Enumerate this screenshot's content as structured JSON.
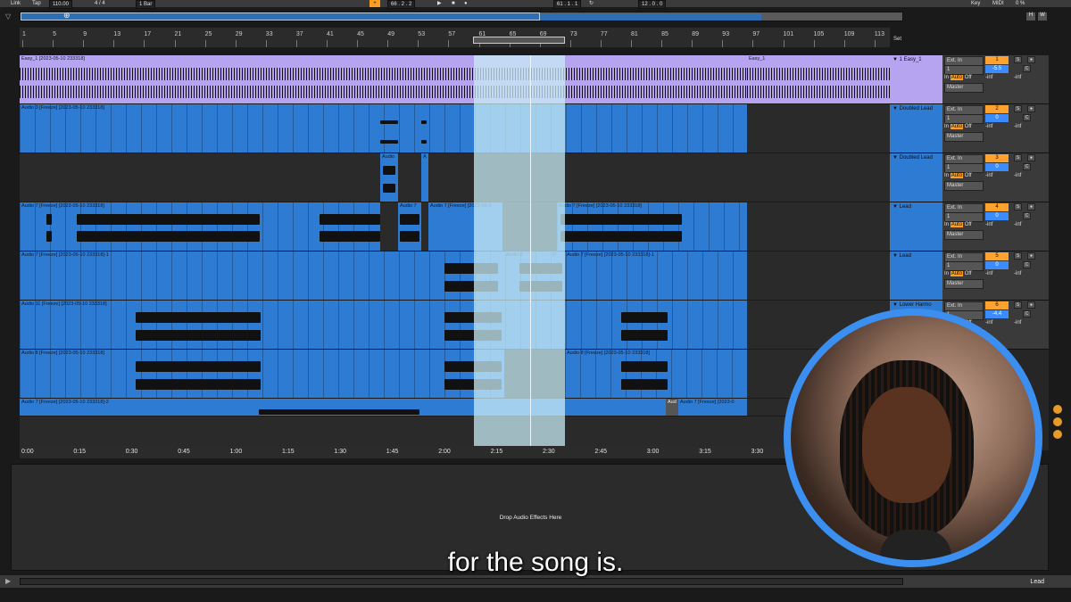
{
  "transport": {
    "link": "Link",
    "tap": "Tap",
    "tempo": "110.00",
    "signature": "4 / 4",
    "quantize": "1 Bar",
    "position": "66 . 2 . 2",
    "loop_start": "61 . 1 . 1",
    "loop_length": "12 . 0 . 0",
    "key": "Key",
    "midi": "MIDI",
    "cpu": "0 %"
  },
  "overview": {
    "h": "H",
    "w": "W"
  },
  "ruler": {
    "bars": [
      "1",
      "5",
      "9",
      "13",
      "17",
      "21",
      "25",
      "29",
      "33",
      "37",
      "41",
      "45",
      "49",
      "53",
      "57",
      "61",
      "65",
      "69",
      "73",
      "77",
      "81",
      "85",
      "89",
      "93",
      "97",
      "101",
      "105",
      "109",
      "113"
    ],
    "set_label": "Set"
  },
  "tracks": [
    {
      "clips": [
        "Easy_1 [2023-05-10 233318]",
        "Easy_1"
      ]
    },
    {
      "clips": [
        "Audio 3 [Freeze] [2023-05-10 233318]"
      ]
    },
    {
      "clips": [
        "Audio",
        "A"
      ]
    },
    {
      "clips": [
        "Audio 7 [Freeze] [2023-05-10 233318]",
        "Audio 7",
        "Audio 7 [Freeze] [2023-05-1",
        "Audio 7 [Freeze] [2023-05-10 233318]"
      ]
    },
    {
      "clips": [
        "Audio 7 [Freeze] [2023-05-10 233318]-1",
        "Audio 8",
        "[2",
        "Audio 7 [Freeze] [2023-05-10 233318]-1"
      ]
    },
    {
      "clips": [
        "Audio 11 [Freeze] [2023-05-10 233318]"
      ]
    },
    {
      "clips": [
        "Audio 8 [Freeze] [2023-05-10 233318]",
        "Audio 8 [Freeze] [2023-05-10 233318]"
      ]
    },
    {
      "clips": [
        "Audio 7 [Freeze] [2023-05-10 233318]-2",
        "Aud",
        "Audio 7 [Freeze] [2023-0"
      ]
    }
  ],
  "heads": [
    {
      "name": "1 Easy_1",
      "input": "Ext. In",
      "ch": "1",
      "monitor_in": "In",
      "monitor_auto": "Auto",
      "monitor_off": "Off",
      "out": "Master",
      "num": "1",
      "vol": "-5.5",
      "s": "S",
      "c": "C",
      "inf1": "-inf",
      "inf2": "-inf"
    },
    {
      "name": "Doubled Lead",
      "input": "Ext. In",
      "ch": "1",
      "monitor_in": "In",
      "monitor_auto": "Auto",
      "monitor_off": "Off",
      "out": "Master",
      "num": "2",
      "vol": "0",
      "s": "S",
      "c": "C",
      "inf1": "-inf",
      "inf2": "-inf"
    },
    {
      "name": "Doubled Lead",
      "input": "Ext. In",
      "ch": "1",
      "monitor_in": "In",
      "monitor_auto": "Auto",
      "monitor_off": "Off",
      "out": "Master",
      "num": "3",
      "vol": "0",
      "s": "S",
      "c": "C",
      "inf1": "-inf",
      "inf2": "-inf"
    },
    {
      "name": "Lead",
      "input": "Ext. In",
      "ch": "1",
      "monitor_in": "In",
      "monitor_auto": "Auto",
      "monitor_off": "Off",
      "out": "Master",
      "num": "4",
      "vol": "0",
      "s": "S",
      "c": "C",
      "inf1": "-inf",
      "inf2": "-inf"
    },
    {
      "name": "Lead",
      "input": "Ext. In",
      "ch": "1",
      "monitor_in": "In",
      "monitor_auto": "Auto",
      "monitor_off": "Off",
      "out": "Master",
      "num": "5",
      "vol": "0",
      "s": "S",
      "c": "C",
      "inf1": "-inf",
      "inf2": "-inf"
    },
    {
      "name": "Lower Harmo",
      "input": "Ext. In",
      "ch": "1",
      "monitor_in": "In",
      "monitor_auto": "Auto",
      "monitor_off": "Off",
      "out": "Master",
      "num": "6",
      "vol": "-4.4",
      "s": "S",
      "c": "C",
      "inf1": "-inf",
      "inf2": "-inf"
    }
  ],
  "timeline": [
    "0:00",
    "0:15",
    "0:30",
    "0:45",
    "1:00",
    "1:15",
    "1:30",
    "1:45",
    "2:00",
    "2:15",
    "2:30",
    "2:45",
    "3:00",
    "3:15",
    "3:30"
  ],
  "device": {
    "drop_label": "Drop Audio Effects Here"
  },
  "bottom": {
    "label": "Lead"
  },
  "subtitle": "for the song is.",
  "colors": {
    "accent_blue": "#2e7bd4",
    "clip_purple": "#b6a4f0",
    "orange": "#ff9d1e",
    "loop_highlight": "#c8ebf5"
  }
}
